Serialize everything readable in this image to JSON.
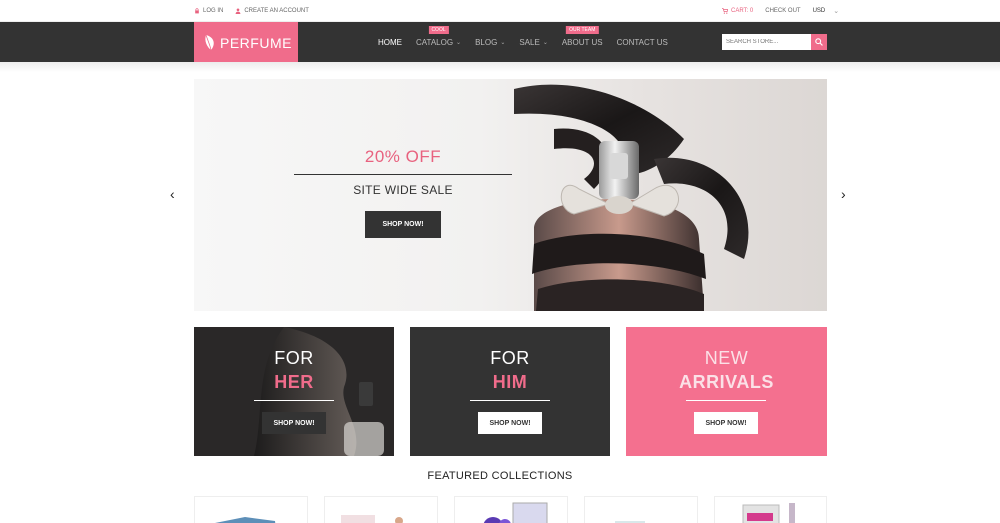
{
  "topbar": {
    "login": "LOG IN",
    "create_account": "CREATE AN ACCOUNT",
    "cart": "CART: 0",
    "checkout": "CHECK OUT",
    "currency": "USD"
  },
  "header": {
    "logo": "PERFUME",
    "nav": [
      {
        "label": "HOME",
        "badge": ""
      },
      {
        "label": "CATALOG",
        "badge": "COOL"
      },
      {
        "label": "BLOG",
        "badge": ""
      },
      {
        "label": "SALE",
        "badge": ""
      },
      {
        "label": "ABOUT US",
        "badge": "OUR TEAM"
      },
      {
        "label": "CONTACT US",
        "badge": ""
      }
    ],
    "search_placeholder": "SEARCH STORE..."
  },
  "slider": {
    "title": "20% OFF",
    "subtitle": "SITE WIDE SALE",
    "button": "SHOP NOW!"
  },
  "banners": [
    {
      "line1": "FOR",
      "line2": "HER",
      "button": "SHOP NOW!"
    },
    {
      "line1": "FOR",
      "line2": "HIM",
      "button": "SHOP NOW!"
    },
    {
      "line1": "NEW",
      "line2": "ARRIVALS",
      "button": "SHOP NOW!"
    }
  ],
  "featured": {
    "title": "FEATURED COLLECTIONS"
  },
  "colors": {
    "accent": "#f06c8b",
    "header_bg": "#333333"
  }
}
